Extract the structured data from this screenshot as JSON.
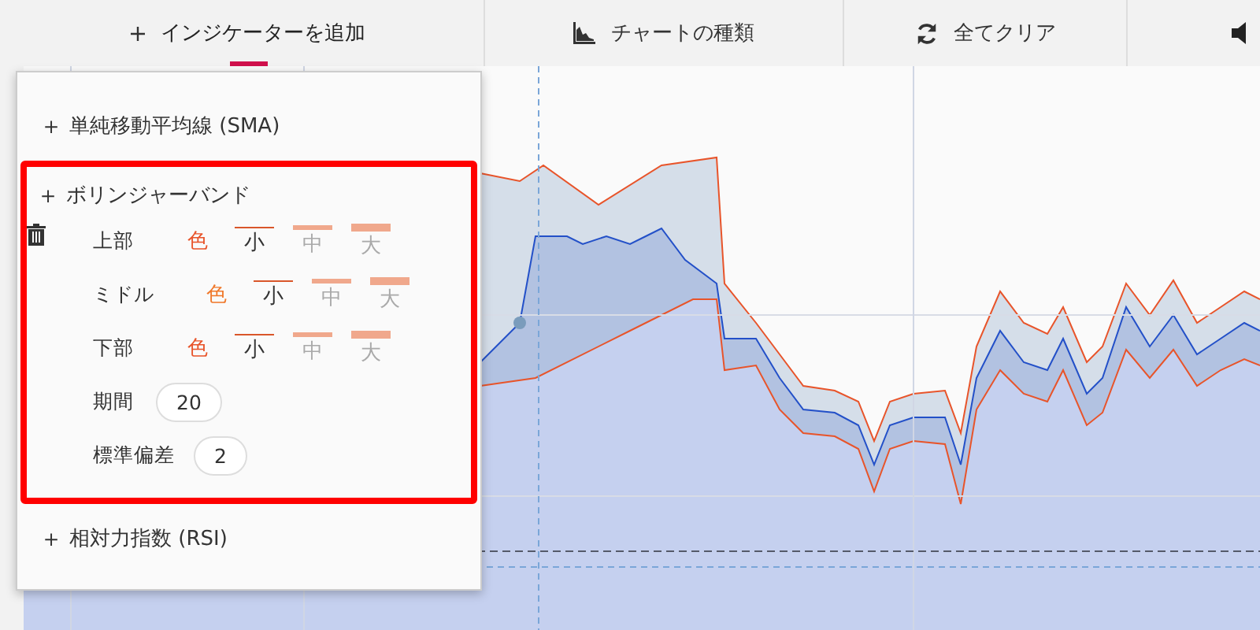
{
  "toolbar": {
    "buttons": [
      {
        "kind": "add",
        "label": "インジケーターを追加",
        "selected": true
      },
      {
        "kind": "chart",
        "label": "チャートの種類",
        "selected": false
      },
      {
        "kind": "clear",
        "label": "全てクリア",
        "selected": false
      }
    ]
  },
  "indicator_menu": {
    "items": [
      {
        "icon": "＋",
        "label": "単純移動平均線 (SMA)",
        "highlighted": false,
        "expanded": false
      },
      {
        "icon": "＋",
        "label": "ボリンジャーバンド",
        "highlighted": true,
        "expanded": true,
        "lines": [
          {
            "label": "上部",
            "color_label": "色",
            "color": "#e8542a",
            "sizes": [
              {
                "label": "小",
                "selected": true
              },
              {
                "label": "中",
                "selected": false
              },
              {
                "label": "大",
                "selected": false
              }
            ]
          },
          {
            "label": "ミドル",
            "color_label": "色",
            "color": "#f0782a",
            "sizes": [
              {
                "label": "小",
                "selected": true
              },
              {
                "label": "中",
                "selected": false
              },
              {
                "label": "大",
                "selected": false
              }
            ]
          },
          {
            "label": "下部",
            "color_label": "色",
            "color": "#e8542a",
            "sizes": [
              {
                "label": "小",
                "selected": true
              },
              {
                "label": "中",
                "selected": false
              },
              {
                "label": "大",
                "selected": false
              }
            ]
          }
        ],
        "params": [
          {
            "label": "期間",
            "value": "20"
          },
          {
            "label": "標準偏差",
            "value": "2"
          }
        ]
      },
      {
        "icon": "＋",
        "label": "相対力指数 (RSI)",
        "highlighted": false,
        "expanded": false
      }
    ]
  }
}
